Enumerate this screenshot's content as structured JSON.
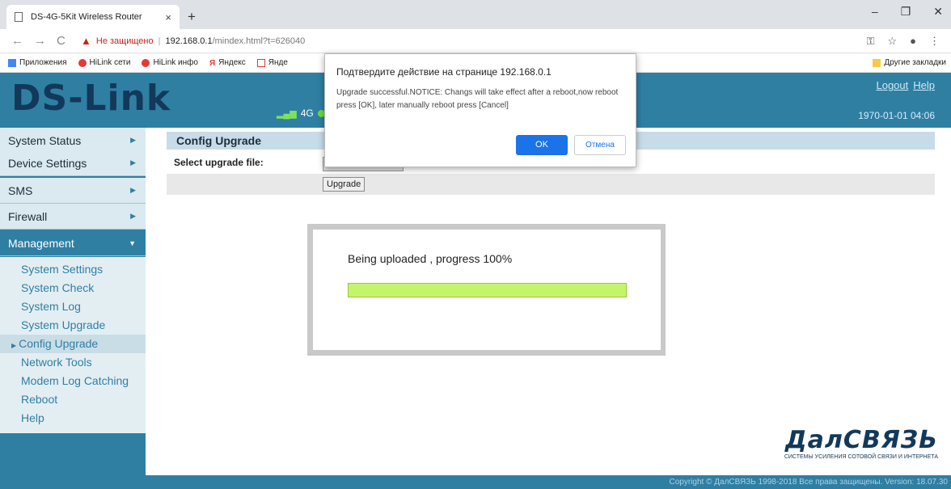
{
  "browser": {
    "tab_title": "DS-4G-5Kit Wireless Router",
    "address_warning": "Не защищено",
    "address_host": "192.168.0.1",
    "address_path": "/mindex.html?t=626040",
    "bookmarks": [
      "Приложения",
      "HiLink сети",
      "HiLink инфо",
      "Яндекс",
      "Янде"
    ],
    "other_bookmarks": "Другие закладки"
  },
  "header": {
    "logo": "DS-Link",
    "network_type": "4G",
    "logout": "Logout",
    "help": "Help",
    "datetime": "1970-01-01 04:06"
  },
  "sidebar": {
    "menu": [
      "System Status",
      "Device Settings",
      "SMS",
      "Firewall",
      "Management"
    ],
    "submenu": [
      "System Settings",
      "System Check",
      "System Log",
      "System Upgrade",
      "Config Upgrade",
      "Network Tools",
      "Modem Log Catching",
      "Reboot",
      "Help"
    ]
  },
  "main": {
    "section_title": "Config Upgrade",
    "select_label": "Select upgrade file:",
    "upgrade_button": "Upgrade"
  },
  "progress": {
    "text": "Being uploaded , progress 100%",
    "value": 1.0
  },
  "confirm": {
    "title": "Подтвердите действие на странице 192.168.0.1",
    "message": "Upgrade successful.NOTICE: Changs will take effect after a reboot,now reboot press [OK], later manually reboot press [Cancel]",
    "ok": "OK",
    "cancel": "Отмена"
  },
  "brand": {
    "name": "ДалСВЯЗЬ",
    "tagline": "СИСТЕМЫ УСИЛЕНИЯ СОТОВОЙ СВЯЗИ И ИНТЕРНЕТА"
  },
  "footer": {
    "copyright": "Copyright © ДалСВЯЗЬ 1998-2018 Все права защищены. Version: 18.07.30"
  },
  "colors": {
    "header_blue": "#2f7fa3",
    "progress_fill": "#c3f56a",
    "ok_button": "#1a73e8"
  }
}
